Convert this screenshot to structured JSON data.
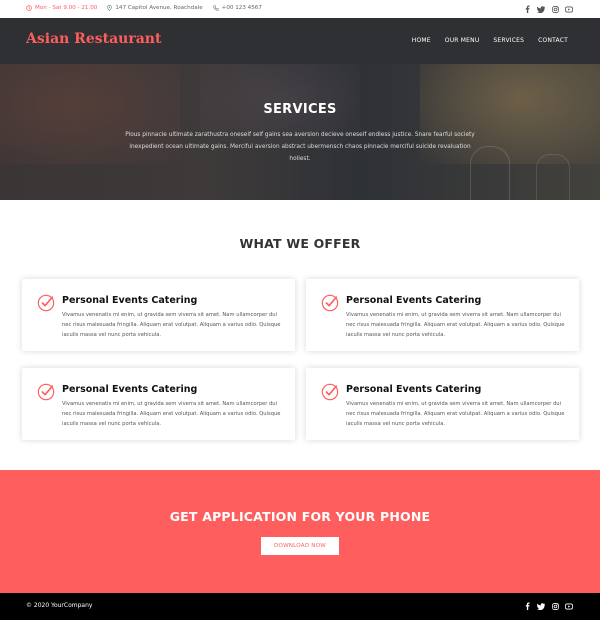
{
  "topbar": {
    "hours": "Mon - Sat 9.00 - 21.00",
    "address": "147 Capitol Avenue, Roachdale",
    "phone": "+00 123 4567",
    "icons": [
      "clock-icon",
      "location-pin-icon",
      "phone-icon"
    ],
    "social_icons": [
      "facebook-icon",
      "twitter-icon",
      "instagram-icon",
      "youtube-icon"
    ]
  },
  "nav": {
    "brand": "Asian Restaurant",
    "links": [
      "HOME",
      "OUR MENU",
      "SERVICES",
      "CONTACT"
    ]
  },
  "hero": {
    "title": "SERVICES",
    "text": "Pious pinnacle ultimate zarathustra oneself self gains sea aversion decieve oneself endless justice. Snare fearful society inexpedient ocean ultimate gains. Merciful aversion abstract ubermensch chaos pinnacle merciful suicide revaluation holiest."
  },
  "offer": {
    "title": "WHAT WE OFFER",
    "cards": [
      {
        "title": "Personal Events Catering",
        "text": "Vivamus venenatis mi enim, ut gravida sem viverra sit amet. Nam ullamcorper dui nec risus malesuada fringilla. Aliquam erat volutpat. Aliquam a varius odio. Quisque iaculis massa vel nunc porta vehicula."
      },
      {
        "title": "Personal Events Catering",
        "text": "Vivamus venenatis mi enim, ut gravida sem viverra sit amet. Nam ullamcorper dui nec risus malesuada fringilla. Aliquam erat volutpat. Aliquam a varius odio. Quisque iaculis massa vel nunc porta vehicula."
      },
      {
        "title": "Personal Events Catering",
        "text": "Vivamus venenatis mi enim, ut gravida sem viverra sit amet. Nam ullamcorper dui nec risus malesuada fringilla. Aliquam erat volutpat. Aliquam a varius odio. Quisque iaculis massa vel nunc porta vehicula."
      },
      {
        "title": "Personal Events Catering",
        "text": "Vivamus venenatis mi enim, ut gravida sem viverra sit amet. Nam ullamcorper dui nec risus malesuada fringilla. Aliquam erat volutpat. Aliquam a varius odio. Quisque iaculis massa vel nunc porta vehicula."
      }
    ]
  },
  "app": {
    "title": "GET APPLICATION FOR YOUR PHONE",
    "button": "DOWNLOAD NOW"
  },
  "footer": {
    "copyright": "© 2020 YourCompany",
    "social_icons": [
      "facebook-icon",
      "twitter-icon",
      "instagram-icon",
      "youtube-icon"
    ]
  },
  "colors": {
    "accent": "#ff5e5e",
    "nav_bg": "#2f3033",
    "footer_bg": "#000000"
  }
}
